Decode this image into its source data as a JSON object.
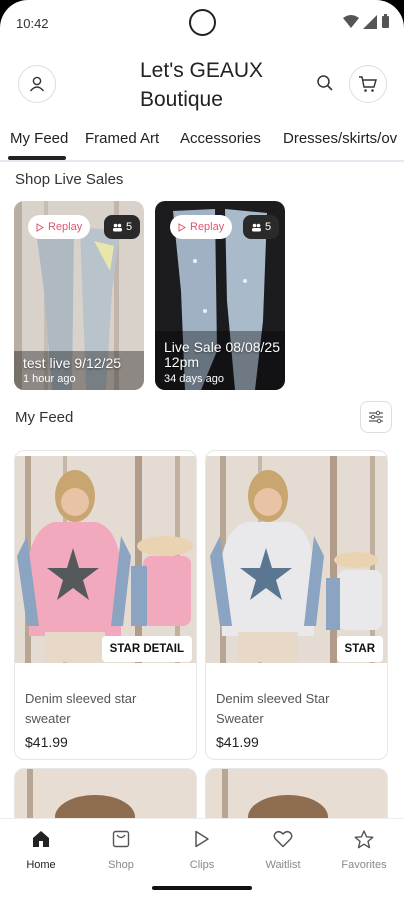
{
  "status_bar": {
    "time": "10:42"
  },
  "header": {
    "brand": "Let's GEAUX Boutique"
  },
  "tabs": [
    {
      "label": "My Feed",
      "active": true
    },
    {
      "label": "Framed Art",
      "active": false
    },
    {
      "label": "Accessories",
      "active": false
    },
    {
      "label": "Dresses/skirts/ov",
      "active": false
    }
  ],
  "live_section": {
    "title": "Shop Live Sales",
    "cards": [
      {
        "replay_label": "Replay",
        "viewers": "5",
        "title": "test live 9/12/25",
        "subtitle": "1 hour ago"
      },
      {
        "replay_label": "Replay",
        "viewers": "5",
        "title": "Live Sale 08/08/25 12pm",
        "subtitle": "34 days ago"
      }
    ]
  },
  "feed_section": {
    "title": "My Feed",
    "items": [
      {
        "tag": "STAR DETAIL",
        "name": "Denim sleeved star sweater",
        "price": "$41.99",
        "sweater_color": "#f2a9bd"
      },
      {
        "tag": "STAR",
        "name": "Denim sleeved Star Sweater",
        "price": "$41.99",
        "sweater_color": "#e9e9ec"
      }
    ]
  },
  "bottom_nav": [
    {
      "label": "Home",
      "icon": "home-icon",
      "active": true
    },
    {
      "label": "Shop",
      "icon": "shop-icon",
      "active": false
    },
    {
      "label": "Clips",
      "icon": "play-icon",
      "active": false
    },
    {
      "label": "Waitlist",
      "icon": "heart-icon",
      "active": false
    },
    {
      "label": "Favorites",
      "icon": "star-icon",
      "active": false
    }
  ]
}
